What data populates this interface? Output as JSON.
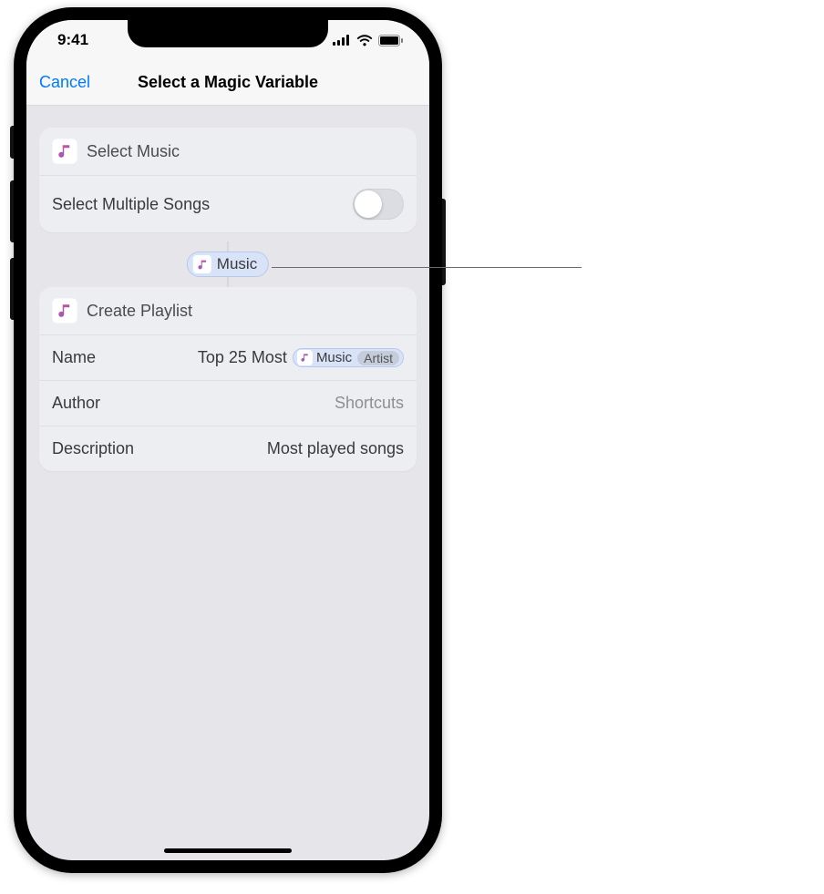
{
  "statusbar": {
    "time": "9:41"
  },
  "nav": {
    "cancel": "Cancel",
    "title": "Select a Magic Variable"
  },
  "select_music": {
    "action_title": "Select Music",
    "multiple_label": "Select Multiple Songs",
    "multiple_on": false
  },
  "connector": {
    "pill_label": "Music"
  },
  "create_playlist": {
    "action_title": "Create Playlist",
    "rows": {
      "name_label": "Name",
      "name_value_text": "Top 25 Most",
      "name_token_label": "Music",
      "name_token_sub": "Artist",
      "author_label": "Author",
      "author_value": "Shortcuts",
      "description_label": "Description",
      "description_value": "Most played songs"
    }
  },
  "icons": {
    "music_note": "music-note-icon",
    "signal": "cellular-signal-icon",
    "wifi": "wifi-icon",
    "battery": "battery-icon"
  },
  "colors": {
    "accent": "#007aff",
    "pill_bg": "#d9e3f8",
    "card_bg": "#eceef2",
    "page_bg": "#e5e5ea"
  }
}
